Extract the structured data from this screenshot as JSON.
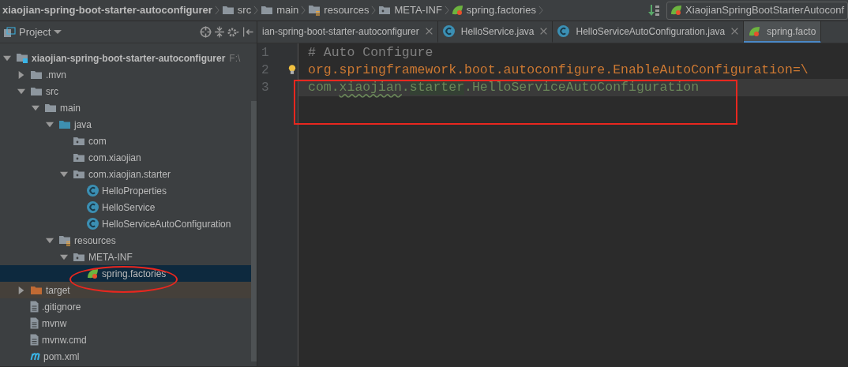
{
  "breadcrumbs": [
    {
      "label": "xiaojian-spring-boot-starter-autoconfigurer",
      "bold": true
    },
    {
      "label": "src",
      "kind": "folder",
      "bold": false
    },
    {
      "label": "main",
      "kind": "folder",
      "bold": false
    },
    {
      "label": "resources",
      "kind": "resources",
      "bold": false
    },
    {
      "label": "META-INF",
      "kind": "package",
      "bold": false
    },
    {
      "label": "spring.factories",
      "kind": "spring",
      "bold": false
    }
  ],
  "run_config": {
    "label": "XiaojianSpringBootStarterAutoconf"
  },
  "project_panel": {
    "title": "Project",
    "tree": [
      {
        "label": "xiaojian-spring-boot-starter-autoconfigurer",
        "path": "F:\\",
        "kind": "module",
        "bold": true,
        "expanded": true,
        "selected": false,
        "children": [
          {
            "label": ".mvn",
            "kind": "folder",
            "expanded": false,
            "selected": false
          },
          {
            "label": "src",
            "kind": "folder",
            "expanded": true,
            "selected": false,
            "children": [
              {
                "label": "main",
                "kind": "folder",
                "expanded": true,
                "selected": false,
                "children": [
                  {
                    "label": "java",
                    "kind": "source",
                    "expanded": true,
                    "selected": false,
                    "children": [
                      {
                        "label": "com",
                        "kind": "package",
                        "selected": false
                      },
                      {
                        "label": "com.xiaojian",
                        "kind": "package",
                        "selected": false
                      },
                      {
                        "label": "com.xiaojian.starter",
                        "kind": "package",
                        "expanded": true,
                        "selected": false,
                        "children": [
                          {
                            "label": "HelloProperties",
                            "kind": "class",
                            "selected": false
                          },
                          {
                            "label": "HelloService",
                            "kind": "class",
                            "selected": false
                          },
                          {
                            "label": "HelloServiceAutoConfiguration",
                            "kind": "class",
                            "selected": false
                          }
                        ]
                      }
                    ]
                  },
                  {
                    "label": "resources",
                    "kind": "resources",
                    "expanded": true,
                    "selected": false,
                    "children": [
                      {
                        "label": "META-INF",
                        "kind": "package",
                        "expanded": true,
                        "selected": false,
                        "children": [
                          {
                            "label": "spring.factories",
                            "kind": "spring",
                            "selected": true
                          }
                        ]
                      }
                    ]
                  }
                ]
              }
            ]
          },
          {
            "label": "target",
            "kind": "excluded",
            "expanded": false,
            "selected": false
          },
          {
            "label": ".gitignore",
            "kind": "file",
            "selected": false
          },
          {
            "label": "mvnw",
            "kind": "file",
            "selected": false
          },
          {
            "label": "mvnw.cmd",
            "kind": "file",
            "selected": false
          },
          {
            "label": "pom.xml",
            "kind": "maven",
            "selected": false
          }
        ]
      }
    ]
  },
  "tabs": [
    {
      "label": "ian-spring-boot-starter-autoconfigurer",
      "selected": false
    },
    {
      "label": "HelloService.java",
      "kind": "class",
      "selected": false
    },
    {
      "label": "HelloServiceAutoConfiguration.java",
      "kind": "class",
      "selected": false
    },
    {
      "label": "spring.facto",
      "kind": "spring",
      "selected": true
    }
  ],
  "editor": {
    "lines": [
      {
        "number": "1",
        "current": false,
        "segments": [
          {
            "text": "# Auto Configure",
            "kind": "comment"
          }
        ]
      },
      {
        "number": "2",
        "current": false,
        "segments": [
          {
            "text": "org.springframework.boot.autoconfigure.EnableAutoConfiguration",
            "kind": "key"
          },
          {
            "text": "=\\",
            "kind": "key"
          }
        ]
      },
      {
        "number": "3",
        "current": true,
        "segments": [
          {
            "text": "com.",
            "kind": "value"
          },
          {
            "text": "xiaojian",
            "kind": "typo"
          },
          {
            "text": ".",
            "kind": "value"
          },
          {
            "text": "starter",
            "kind": "highlight"
          },
          {
            "text": ".HelloServiceAutoConfiguration",
            "kind": "value"
          }
        ]
      }
    ]
  }
}
